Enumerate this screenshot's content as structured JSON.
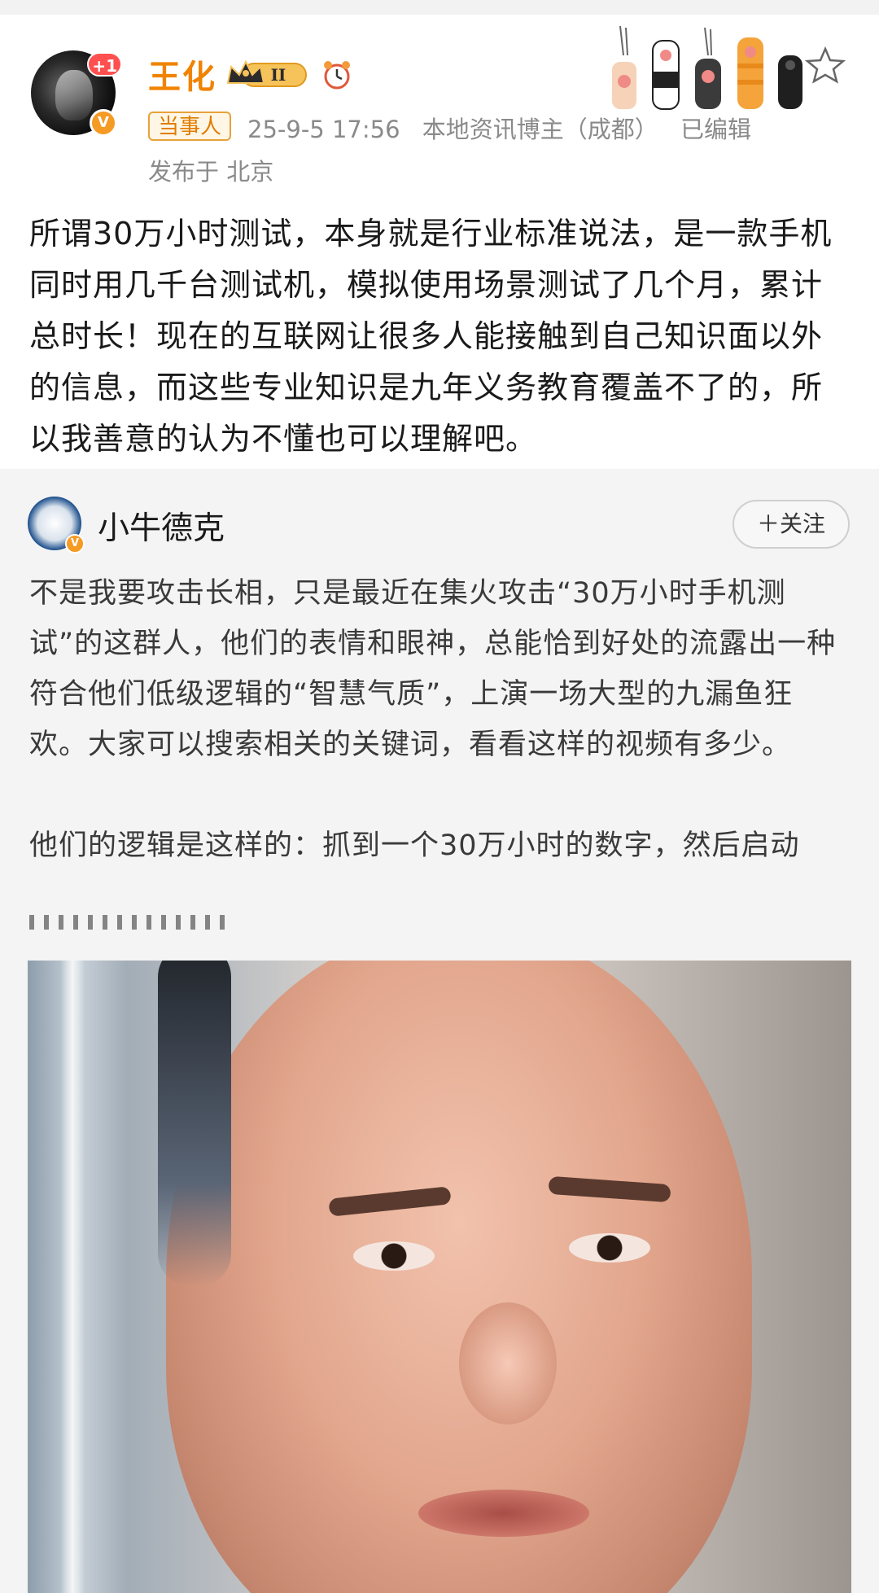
{
  "post": {
    "author": "王化",
    "level_badge": "II",
    "avatar_plus": "+1",
    "verified_mark": "V",
    "tag": "当事人",
    "timestamp": "25-9-5 17:56",
    "author_desc": "本地资讯博主（成都）",
    "edited": "已编辑",
    "location": "发布于 北京",
    "text": "所谓30万小时测试，本身就是行业标准说法，是一款手机同时用几千台测试机，模拟使用场景测试了几个月，累计总时长！现在的互联网让很多人能接触到自己知识面以外的信息，而这些专业知识是九年义务教育覆盖不了的，所以我善意的认为不懂也可以理解吧。"
  },
  "icons": {
    "crown": "crown-icon",
    "alarm": "alarm-clock-icon",
    "paws": "cat-paws-decoration",
    "star": "star-icon"
  },
  "quote": {
    "author": "小牛德克",
    "verified_mark": "V",
    "follow_label": "＋关注",
    "paragraph1": "不是我要攻击长相，只是最近在集火攻击“30万小时手机测试”的这群人，他们的表情和眼神，总能恰到好处的流露出一种符合他们低级逻辑的“智慧气质”，上演一场大型的九漏鱼狂欢。大家可以搜索相关的关键词，看看这样的视频有多少。",
    "paragraph2": "他们的逻辑是这样的：抓到一个30万小时的数字，然后启动"
  },
  "colors": {
    "username": "#f08300",
    "tag_border": "#e8a23a",
    "meta_gray": "#8a8a8a",
    "quote_bg": "#f4f4f4",
    "badge_red": "#ff4f4f",
    "verified_orange": "#f59a23"
  }
}
